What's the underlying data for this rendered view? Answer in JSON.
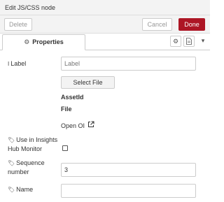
{
  "tray": {
    "title": "Edit JS/CSS node"
  },
  "toolbar": {
    "delete_label": "Delete",
    "cancel_label": "Cancel",
    "done_label": "Done",
    "done_color": "#ad1625"
  },
  "tabs": {
    "properties_label": "Properties",
    "icons": [
      "gear-icon",
      "doc-icon",
      "caret-down-icon"
    ]
  },
  "form": {
    "label": {
      "label": "Label",
      "placeholder": "Label",
      "icon": "text-cursor-icon"
    },
    "select_file_label": "Select File",
    "assetid_label": "AssetId",
    "file_label": "File",
    "open_label": "Open OI",
    "insights": {
      "label_line1": "Use in Insights",
      "label_line2": "Hub Monitor",
      "checked": false,
      "icon": "tag-icon"
    },
    "sequence": {
      "label_line1": "Sequence",
      "label_line2": "number",
      "value": "3",
      "icon": "tag-icon"
    },
    "name": {
      "label": "Name",
      "value": "",
      "icon": "tag-icon"
    }
  }
}
